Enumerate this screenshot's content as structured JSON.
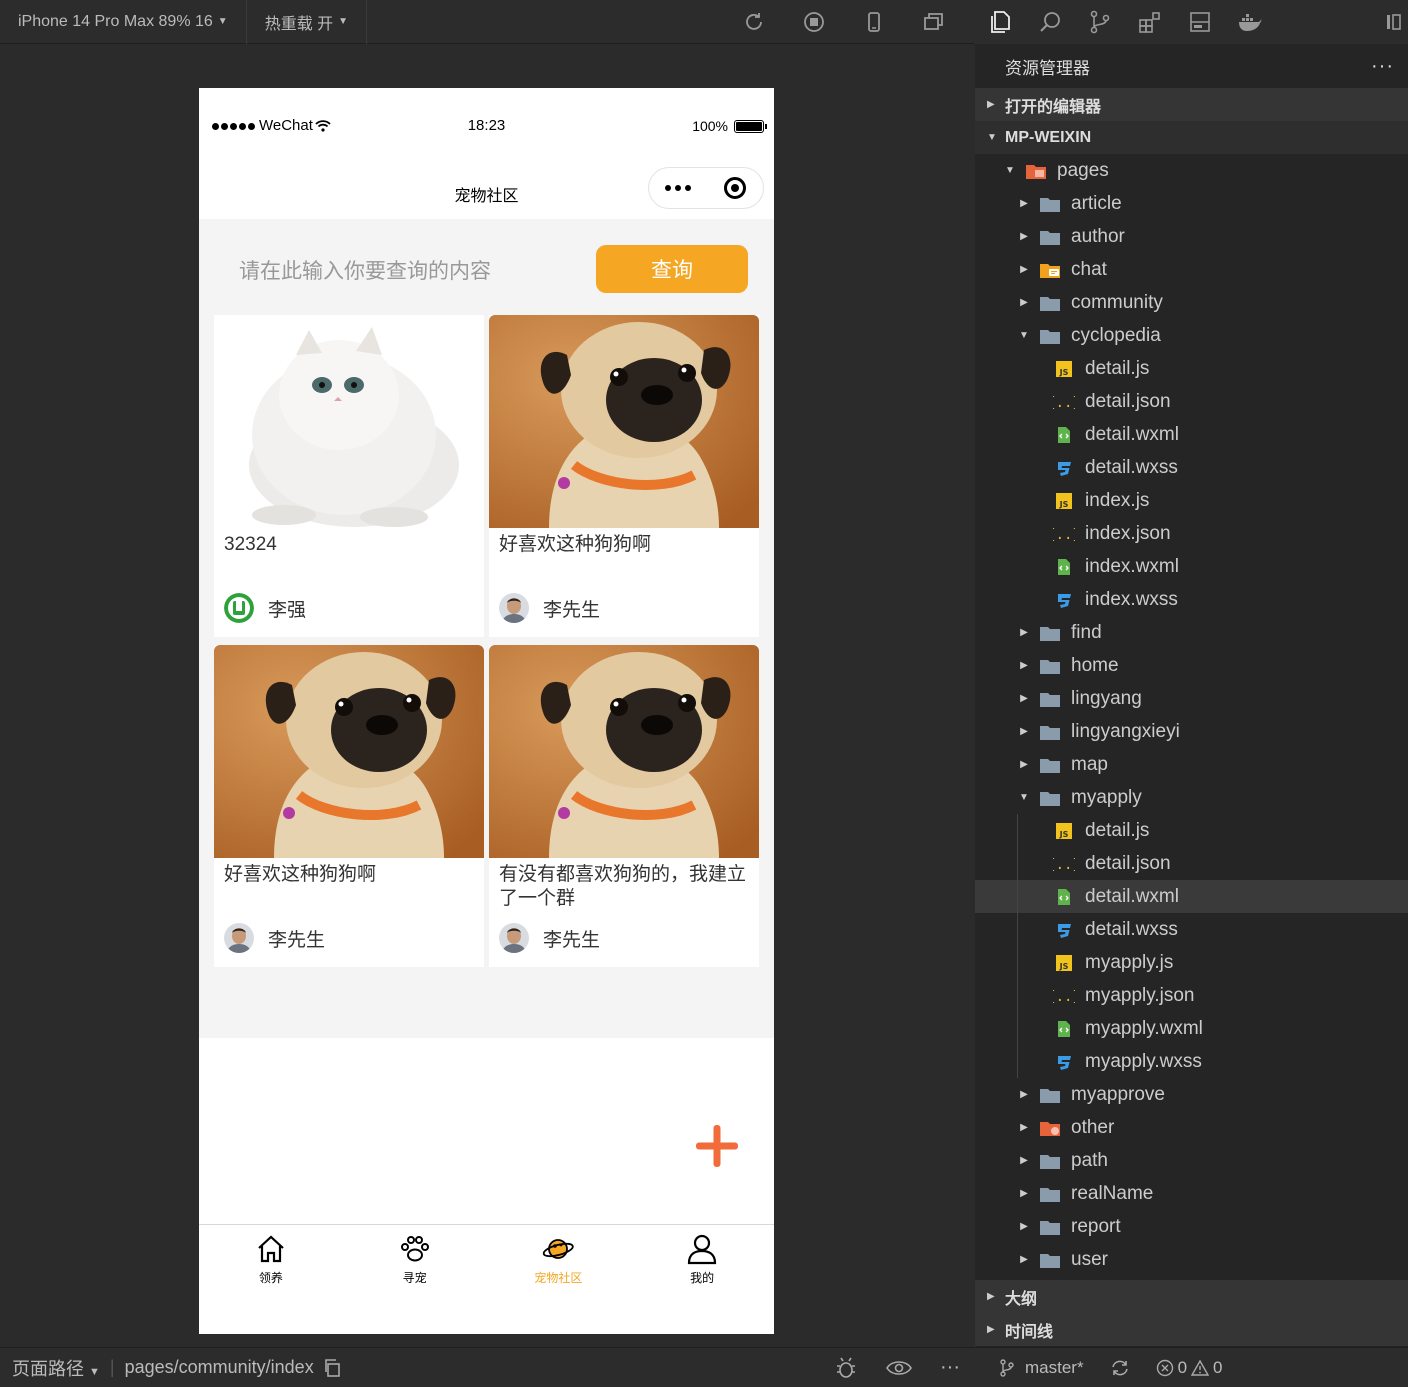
{
  "simulator": {
    "device_label": "iPhone 14 Pro Max 89% 16",
    "hot_reload_label": "热重载 开",
    "page_path_label": "页面路径",
    "page_path_value": "pages/community/index"
  },
  "phone": {
    "status": {
      "carrier": "WeChat",
      "time": "18:23",
      "battery": "100%"
    },
    "nav_title": "宠物社区",
    "search": {
      "placeholder": "请在此输入你要查询的内容",
      "button": "查询"
    },
    "posts": [
      {
        "caption": "32324",
        "author": "李强",
        "image": "white-persian-cat",
        "avatar": "green-logo"
      },
      {
        "caption": "好喜欢这种狗狗啊",
        "author": "李先生",
        "image": "pug-dog",
        "avatar": "man-photo"
      },
      {
        "caption": "好喜欢这种狗狗啊",
        "author": "李先生",
        "image": "pug-dog",
        "avatar": "man-photo"
      },
      {
        "caption": "有没有都喜欢狗狗的，我建立了一个群",
        "author": "李先生",
        "image": "pug-dog",
        "avatar": "man-photo"
      }
    ],
    "tabs": [
      {
        "label": "领养",
        "icon": "home-icon",
        "active": false
      },
      {
        "label": "寻宠",
        "icon": "paw-icon",
        "active": false
      },
      {
        "label": "宠物社区",
        "icon": "planet-icon",
        "active": true
      },
      {
        "label": "我的",
        "icon": "user-icon",
        "active": false
      }
    ],
    "accent_color": "#f5a623"
  },
  "explorer": {
    "title": "资源管理器",
    "sections": {
      "open_editors": "打开的编辑器",
      "project": "MP-WEIXIN",
      "outline": "大纲",
      "timeline": "时间线"
    },
    "tree": [
      {
        "name": "pages",
        "type": "folder-special",
        "expanded": true
      },
      {
        "name": "article",
        "type": "folder"
      },
      {
        "name": "author",
        "type": "folder"
      },
      {
        "name": "chat",
        "type": "folder-chat"
      },
      {
        "name": "community",
        "type": "folder"
      },
      {
        "name": "cyclopedia",
        "type": "folder",
        "expanded": true
      },
      {
        "name": "detail.js",
        "type": "js"
      },
      {
        "name": "detail.json",
        "type": "json"
      },
      {
        "name": "detail.wxml",
        "type": "wxml"
      },
      {
        "name": "detail.wxss",
        "type": "wxss"
      },
      {
        "name": "index.js",
        "type": "js"
      },
      {
        "name": "index.json",
        "type": "json"
      },
      {
        "name": "index.wxml",
        "type": "wxml"
      },
      {
        "name": "index.wxss",
        "type": "wxss"
      },
      {
        "name": "find",
        "type": "folder"
      },
      {
        "name": "home",
        "type": "folder"
      },
      {
        "name": "lingyang",
        "type": "folder"
      },
      {
        "name": "lingyangxieyi",
        "type": "folder"
      },
      {
        "name": "map",
        "type": "folder"
      },
      {
        "name": "myapply",
        "type": "folder",
        "expanded": true
      },
      {
        "name": "detail.js",
        "type": "js"
      },
      {
        "name": "detail.json",
        "type": "json"
      },
      {
        "name": "detail.wxml",
        "type": "wxml",
        "selected": true
      },
      {
        "name": "detail.wxss",
        "type": "wxss"
      },
      {
        "name": "myapply.js",
        "type": "js"
      },
      {
        "name": "myapply.json",
        "type": "json"
      },
      {
        "name": "myapply.wxml",
        "type": "wxml"
      },
      {
        "name": "myapply.wxss",
        "type": "wxss"
      },
      {
        "name": "myapprove",
        "type": "folder"
      },
      {
        "name": "other",
        "type": "folder-red"
      },
      {
        "name": "path",
        "type": "folder"
      },
      {
        "name": "realName",
        "type": "folder"
      },
      {
        "name": "report",
        "type": "folder"
      },
      {
        "name": "user",
        "type": "folder"
      }
    ],
    "status": {
      "branch": "master*",
      "errors": "0",
      "warnings": "0"
    }
  }
}
